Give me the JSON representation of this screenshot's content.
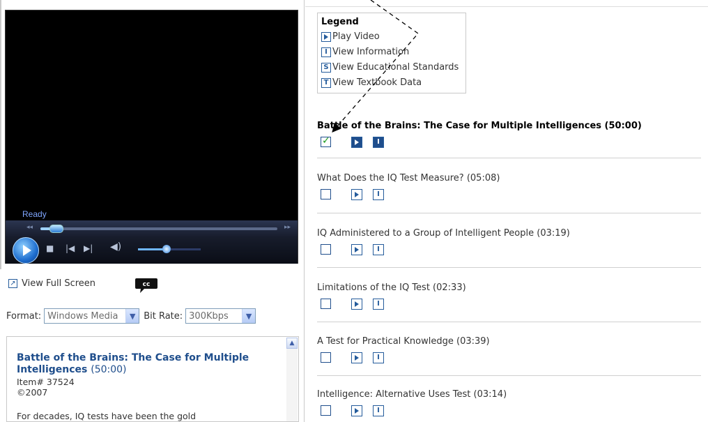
{
  "player": {
    "status": "Ready"
  },
  "links": {
    "full_screen": "View Full Screen"
  },
  "format": {
    "label": "Format:",
    "value": "Windows Media",
    "bitrate_label": "Bit Rate:",
    "bitrate_value": "300Kbps"
  },
  "info": {
    "title": "Battle of the Brains: The Case for Multiple Intelligences",
    "duration": "(50:00)",
    "item": "Item# 37524",
    "copyright": "©2007",
    "description": "For decades, IQ tests have been the gold"
  },
  "legend": {
    "title": "Legend",
    "items": [
      {
        "glyph": "",
        "label": "Play Video"
      },
      {
        "glyph": "I",
        "label": "View Information"
      },
      {
        "glyph": "S",
        "label": "View Educational Standards"
      },
      {
        "glyph": "T",
        "label": "View Textbook Data"
      }
    ]
  },
  "clips": [
    {
      "title": "Battle of the Brains: The Case for Multiple Intelligences (50:00)",
      "checked": true
    },
    {
      "title": "What Does the IQ Test Measure? (05:08)",
      "checked": false
    },
    {
      "title": "IQ Administered to a Group of Intelligent People (03:19)",
      "checked": false
    },
    {
      "title": "Limitations of the IQ Test (02:33)",
      "checked": false
    },
    {
      "title": "A Test for Practical Knowledge (03:39)",
      "checked": false
    },
    {
      "title": "Intelligence: Alternative Uses Test (03:14)",
      "checked": false
    }
  ],
  "controls": {
    "seek_progress": 0.05,
    "volume_level": 0.45
  }
}
